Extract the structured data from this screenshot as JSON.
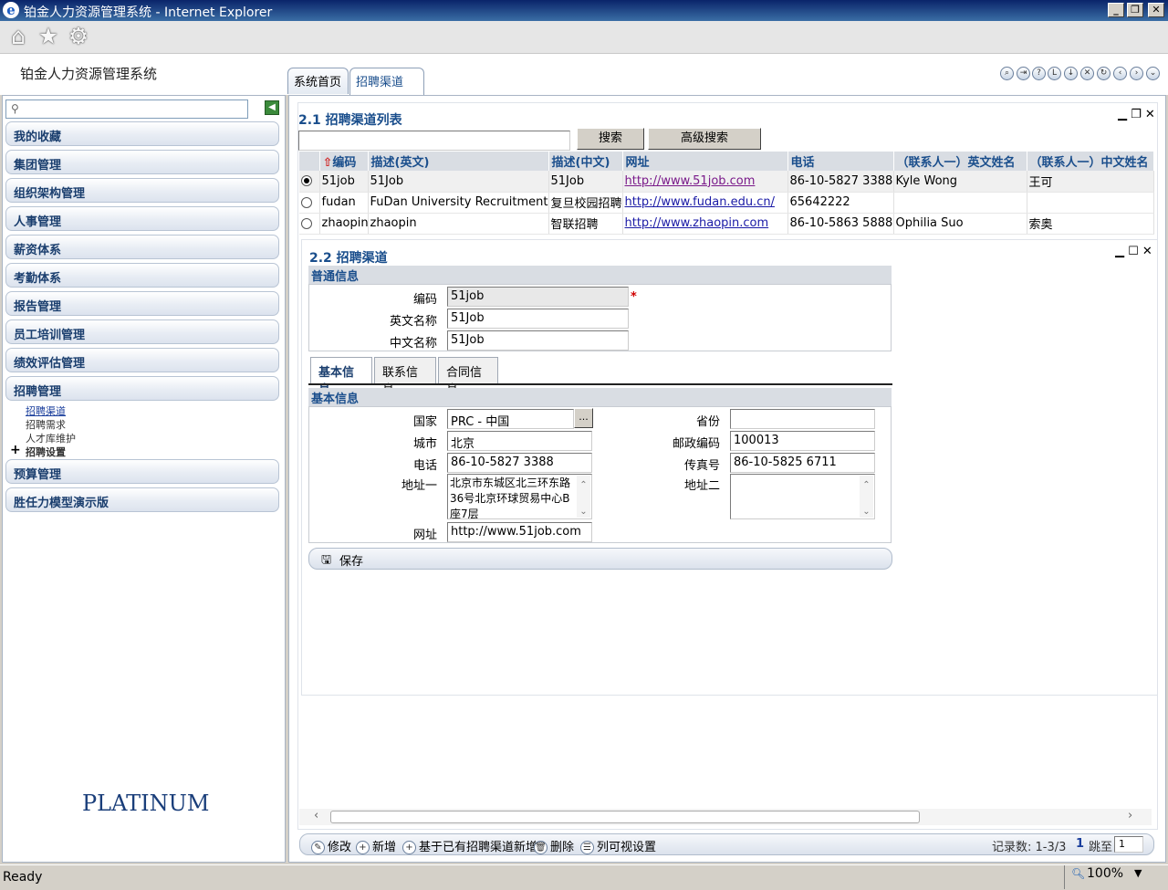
{
  "window": {
    "title": "铂金人力资源管理系统 - Internet Explorer",
    "ie_glyph": "e"
  },
  "app": {
    "name": "铂金人力资源管理系统",
    "logo_text": "PLATINUM"
  },
  "tabs": [
    {
      "label": "系统首页"
    },
    {
      "label": "招聘渠道"
    }
  ],
  "sidebar": {
    "search_value": "",
    "items": [
      {
        "label": "我的收藏"
      },
      {
        "label": "集团管理"
      },
      {
        "label": "组织架构管理"
      },
      {
        "label": "人事管理"
      },
      {
        "label": "薪资体系"
      },
      {
        "label": "考勤体系"
      },
      {
        "label": "报告管理"
      },
      {
        "label": "员工培训管理"
      },
      {
        "label": "绩效评估管理"
      },
      {
        "label": "招聘管理"
      },
      {
        "label": "预算管理"
      },
      {
        "label": "胜任力模型演示版"
      }
    ],
    "subitems": [
      {
        "label": "招聘渠道"
      },
      {
        "label": "招聘需求"
      },
      {
        "label": "人才库维护"
      },
      {
        "label": "招聘设置"
      }
    ],
    "expand_glyph": "+"
  },
  "list": {
    "title": "2.1 招聘渠道列表",
    "search_button": "搜索",
    "advanced_search_button": "高级搜索",
    "columns": [
      "编码",
      "描述(英文)",
      "描述(中文)",
      "网址",
      "电话",
      "（联系人一）英文姓名",
      "（联系人一）中文姓名"
    ],
    "rows": [
      {
        "code": "51job",
        "desc_en": "51Job",
        "desc_cn": "51Job",
        "url": "http://www.51job.com",
        "phone": "86-10-5827 3388",
        "contact_en": "Kyle Wong",
        "contact_cn": "王可"
      },
      {
        "code": "fudan",
        "desc_en": "FuDan University Recruitment",
        "desc_cn": "复旦校园招聘",
        "url": "http://www.fudan.edu.cn/",
        "phone": "65642222",
        "contact_en": "",
        "contact_cn": ""
      },
      {
        "code": "zhaopin",
        "desc_en": "zhaopin",
        "desc_cn": "智联招聘",
        "url": "http://www.zhaopin.com",
        "phone": "86-10-5863 5888",
        "contact_en": "Ophilia Suo",
        "contact_cn": "索奥"
      }
    ],
    "selected_row": "51job"
  },
  "detail": {
    "title": "2.2 招聘渠道",
    "general_label": "普通信息",
    "code_label": "编码",
    "code_value": "51job",
    "required_mark": "*",
    "en_name_label": "英文名称",
    "en_name_value": "51Job",
    "cn_name_label": "中文名称",
    "cn_name_value": "51Job",
    "tabs": [
      {
        "label": "基本信息"
      },
      {
        "label": "联系信息"
      },
      {
        "label": "合同信息"
      }
    ],
    "basic_label": "基本信息",
    "country_label": "国家",
    "country_value": "PRC - 中国",
    "ellipsis": "...",
    "province_label": "省份",
    "province_value": "",
    "city_label": "城市",
    "city_value": "北京",
    "postcode_label": "邮政编码",
    "postcode_value": "100013",
    "phone_label": "电话",
    "phone_value": "86-10-5827 3388",
    "fax_label": "传真号",
    "fax_value": "86-10-5825 6711",
    "addr1_label": "地址一",
    "addr1_value": "北京市东城区北三环东路36号北京环球贸易中心B座7层",
    "addr2_label": "地址二",
    "addr2_value": "",
    "website_label": "网址",
    "website_value": "http://www.51job.com",
    "save_button": "保存"
  },
  "actions": [
    {
      "label": "修改"
    },
    {
      "label": "新增"
    },
    {
      "label": "基于已有招聘渠道新增"
    },
    {
      "label": "删除"
    },
    {
      "label": "列可视设置"
    }
  ],
  "pager": {
    "records": "记录数: 1-3/3",
    "page": "1",
    "goto_label": "跳至",
    "goto_value": "1"
  },
  "status": {
    "text": "Ready",
    "zoom": "100%"
  }
}
